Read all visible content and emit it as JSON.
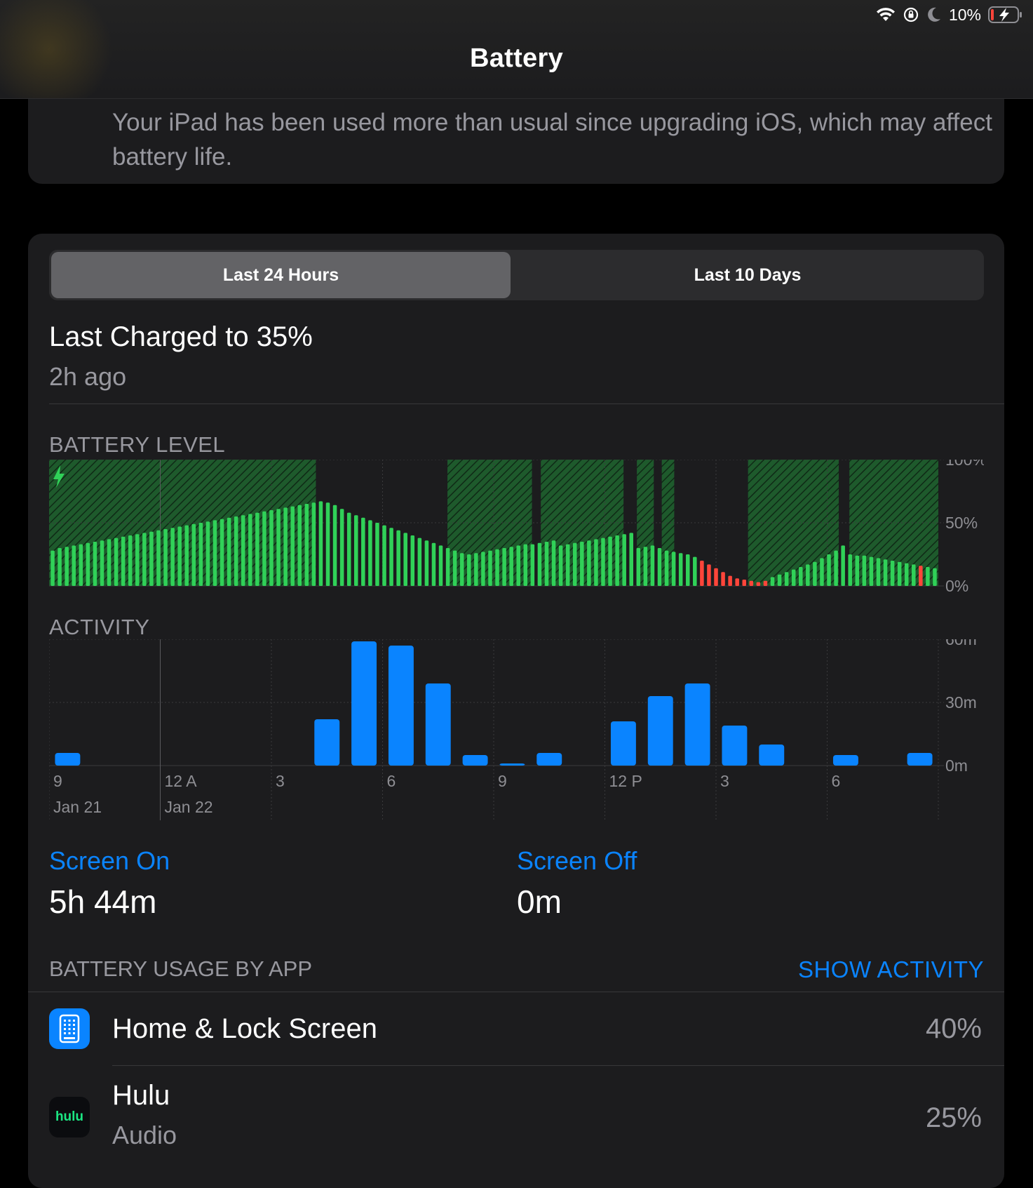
{
  "status_bar": {
    "battery_percent": "10%",
    "icons": [
      "wifi-icon",
      "orientation-lock-icon",
      "moon-icon",
      "battery-charging-icon"
    ]
  },
  "nav": {
    "title": "Battery"
  },
  "notice": {
    "text": "Your iPad has been used more than usual since upgrading iOS, which may affect battery life."
  },
  "segments": {
    "active": "Last 24 Hours",
    "inactive": "Last 10 Days"
  },
  "last_charged": {
    "title": "Last Charged to 35%",
    "subtitle": "2h ago"
  },
  "battery_level": {
    "label": "BATTERY LEVEL"
  },
  "activity": {
    "label": "ACTIVITY"
  },
  "screen_on": {
    "label": "Screen On",
    "value": "5h 44m"
  },
  "screen_off": {
    "label": "Screen Off",
    "value": "0m"
  },
  "usage": {
    "label": "BATTERY USAGE BY APP",
    "show_activity": "SHOW ACTIVITY",
    "apps": [
      {
        "name": "Home & Lock Screen",
        "subtitle": "",
        "percent": "40%",
        "icon": "home-lock-screen-icon"
      },
      {
        "name": "Hulu",
        "subtitle": "Audio",
        "percent": "25%",
        "icon": "hulu-icon",
        "icon_text": "hulu"
      }
    ]
  },
  "chart_data": [
    {
      "type": "bar",
      "name": "battery-level",
      "y_ticks": [
        "100%",
        "50%",
        "0%"
      ],
      "ylim": [
        0,
        100
      ],
      "x_labels": [
        "9",
        "12 A",
        "3",
        "6",
        "9",
        "12 P",
        "3",
        "6"
      ],
      "date_labels": [
        "Jan 21",
        "Jan 22"
      ],
      "colors": {
        "normal": "#30d158",
        "low": "#ff453a",
        "charging_fill": "#1e5a2c"
      },
      "values": [
        28,
        30,
        31,
        32,
        33,
        34,
        35,
        36,
        37,
        38,
        39,
        40,
        41,
        42,
        43,
        44,
        45,
        46,
        47,
        48,
        49,
        50,
        51,
        52,
        53,
        54,
        55,
        56,
        57,
        58,
        59,
        60,
        61,
        62,
        63,
        64,
        65,
        66,
        67,
        66,
        64,
        61,
        58,
        56,
        54,
        52,
        50,
        48,
        46,
        44,
        42,
        40,
        38,
        36,
        34,
        32,
        30,
        28,
        26,
        25,
        26,
        27,
        28,
        29,
        30,
        31,
        32,
        33,
        33,
        34,
        35,
        36,
        32,
        33,
        34,
        35,
        36,
        37,
        38,
        39,
        40,
        41,
        42,
        30,
        31,
        32,
        30,
        28,
        27,
        26,
        25,
        23,
        20,
        17,
        14,
        11,
        8,
        6,
        5,
        4,
        3,
        4,
        7,
        9,
        11,
        13,
        15,
        17,
        19,
        22,
        25,
        28,
        32,
        25,
        24,
        24,
        23,
        22,
        21,
        20,
        19,
        18,
        17,
        16,
        15,
        14
      ],
      "low_indices": [
        92,
        93,
        94,
        95,
        96,
        97,
        98,
        99,
        100,
        101,
        123
      ],
      "charging_intervals_fraction": [
        [
          0,
          0.3
        ],
        [
          0.448,
          0.543
        ],
        [
          0.553,
          0.646
        ],
        [
          0.661,
          0.68
        ],
        [
          0.689,
          0.703
        ],
        [
          0.786,
          0.888
        ],
        [
          0.9,
          1.0
        ]
      ]
    },
    {
      "type": "bar",
      "name": "activity",
      "y_ticks": [
        "60m",
        "30m",
        "0m"
      ],
      "ylim": [
        0,
        60
      ],
      "x_labels": [
        "9",
        "12 A",
        "3",
        "6",
        "9",
        "12 P",
        "3",
        "6"
      ],
      "date_labels": [
        "Jan 21",
        "Jan 22"
      ],
      "color": "#0a84ff",
      "values": [
        6,
        0,
        0,
        0,
        0,
        0,
        0,
        22,
        59,
        57,
        39,
        5,
        1,
        6,
        0,
        21,
        33,
        39,
        19,
        10,
        0,
        5,
        0,
        6
      ]
    }
  ]
}
